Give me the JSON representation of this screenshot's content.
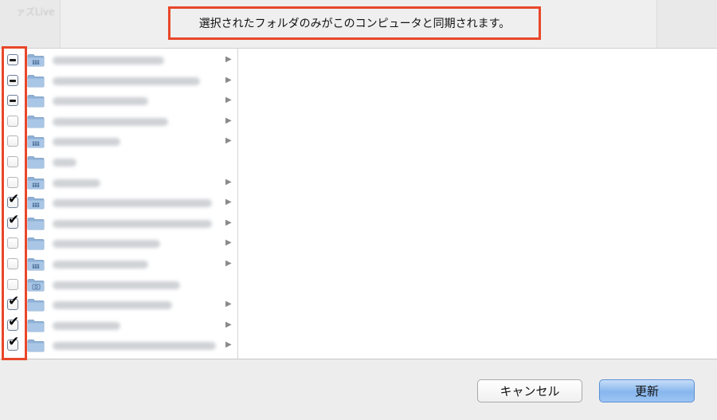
{
  "background_window": {
    "title": "ァズLive"
  },
  "notice": "選択されたフォルダのみがこのコンピュータと同期されます。",
  "folders": [
    {
      "state": "mixed",
      "icon": "shared-folder-icon",
      "has_children": true,
      "blur_w": 140
    },
    {
      "state": "mixed",
      "icon": "folder-icon",
      "has_children": true,
      "blur_w": 185
    },
    {
      "state": "mixed",
      "icon": "folder-icon",
      "has_children": true,
      "blur_w": 120
    },
    {
      "state": "unchecked",
      "icon": "folder-icon",
      "has_children": true,
      "blur_w": 145
    },
    {
      "state": "unchecked",
      "icon": "shared-folder-icon",
      "has_children": true,
      "blur_w": 85
    },
    {
      "state": "unchecked",
      "icon": "folder-icon",
      "has_children": false,
      "blur_w": 30
    },
    {
      "state": "unchecked",
      "icon": "shared-folder-icon",
      "has_children": true,
      "blur_w": 60
    },
    {
      "state": "checked",
      "icon": "shared-folder-icon",
      "has_children": true,
      "blur_w": 200
    },
    {
      "state": "checked",
      "icon": "folder-icon",
      "has_children": true,
      "blur_w": 200
    },
    {
      "state": "unchecked",
      "icon": "folder-icon",
      "has_children": true,
      "blur_w": 135
    },
    {
      "state": "unchecked",
      "icon": "shared-folder-icon",
      "has_children": true,
      "blur_w": 120
    },
    {
      "state": "unchecked",
      "icon": "camera-folder-icon",
      "has_children": false,
      "blur_w": 160
    },
    {
      "state": "checked",
      "icon": "folder-icon",
      "has_children": true,
      "blur_w": 150
    },
    {
      "state": "checked",
      "icon": "folder-icon",
      "has_children": true,
      "blur_w": 85
    },
    {
      "state": "checked",
      "icon": "folder-icon",
      "has_children": true,
      "blur_w": 205
    }
  ],
  "buttons": {
    "cancel": "キャンセル",
    "update": "更新"
  },
  "colors": {
    "highlight": "#e8472a",
    "primary_button": "#87b6ee"
  }
}
